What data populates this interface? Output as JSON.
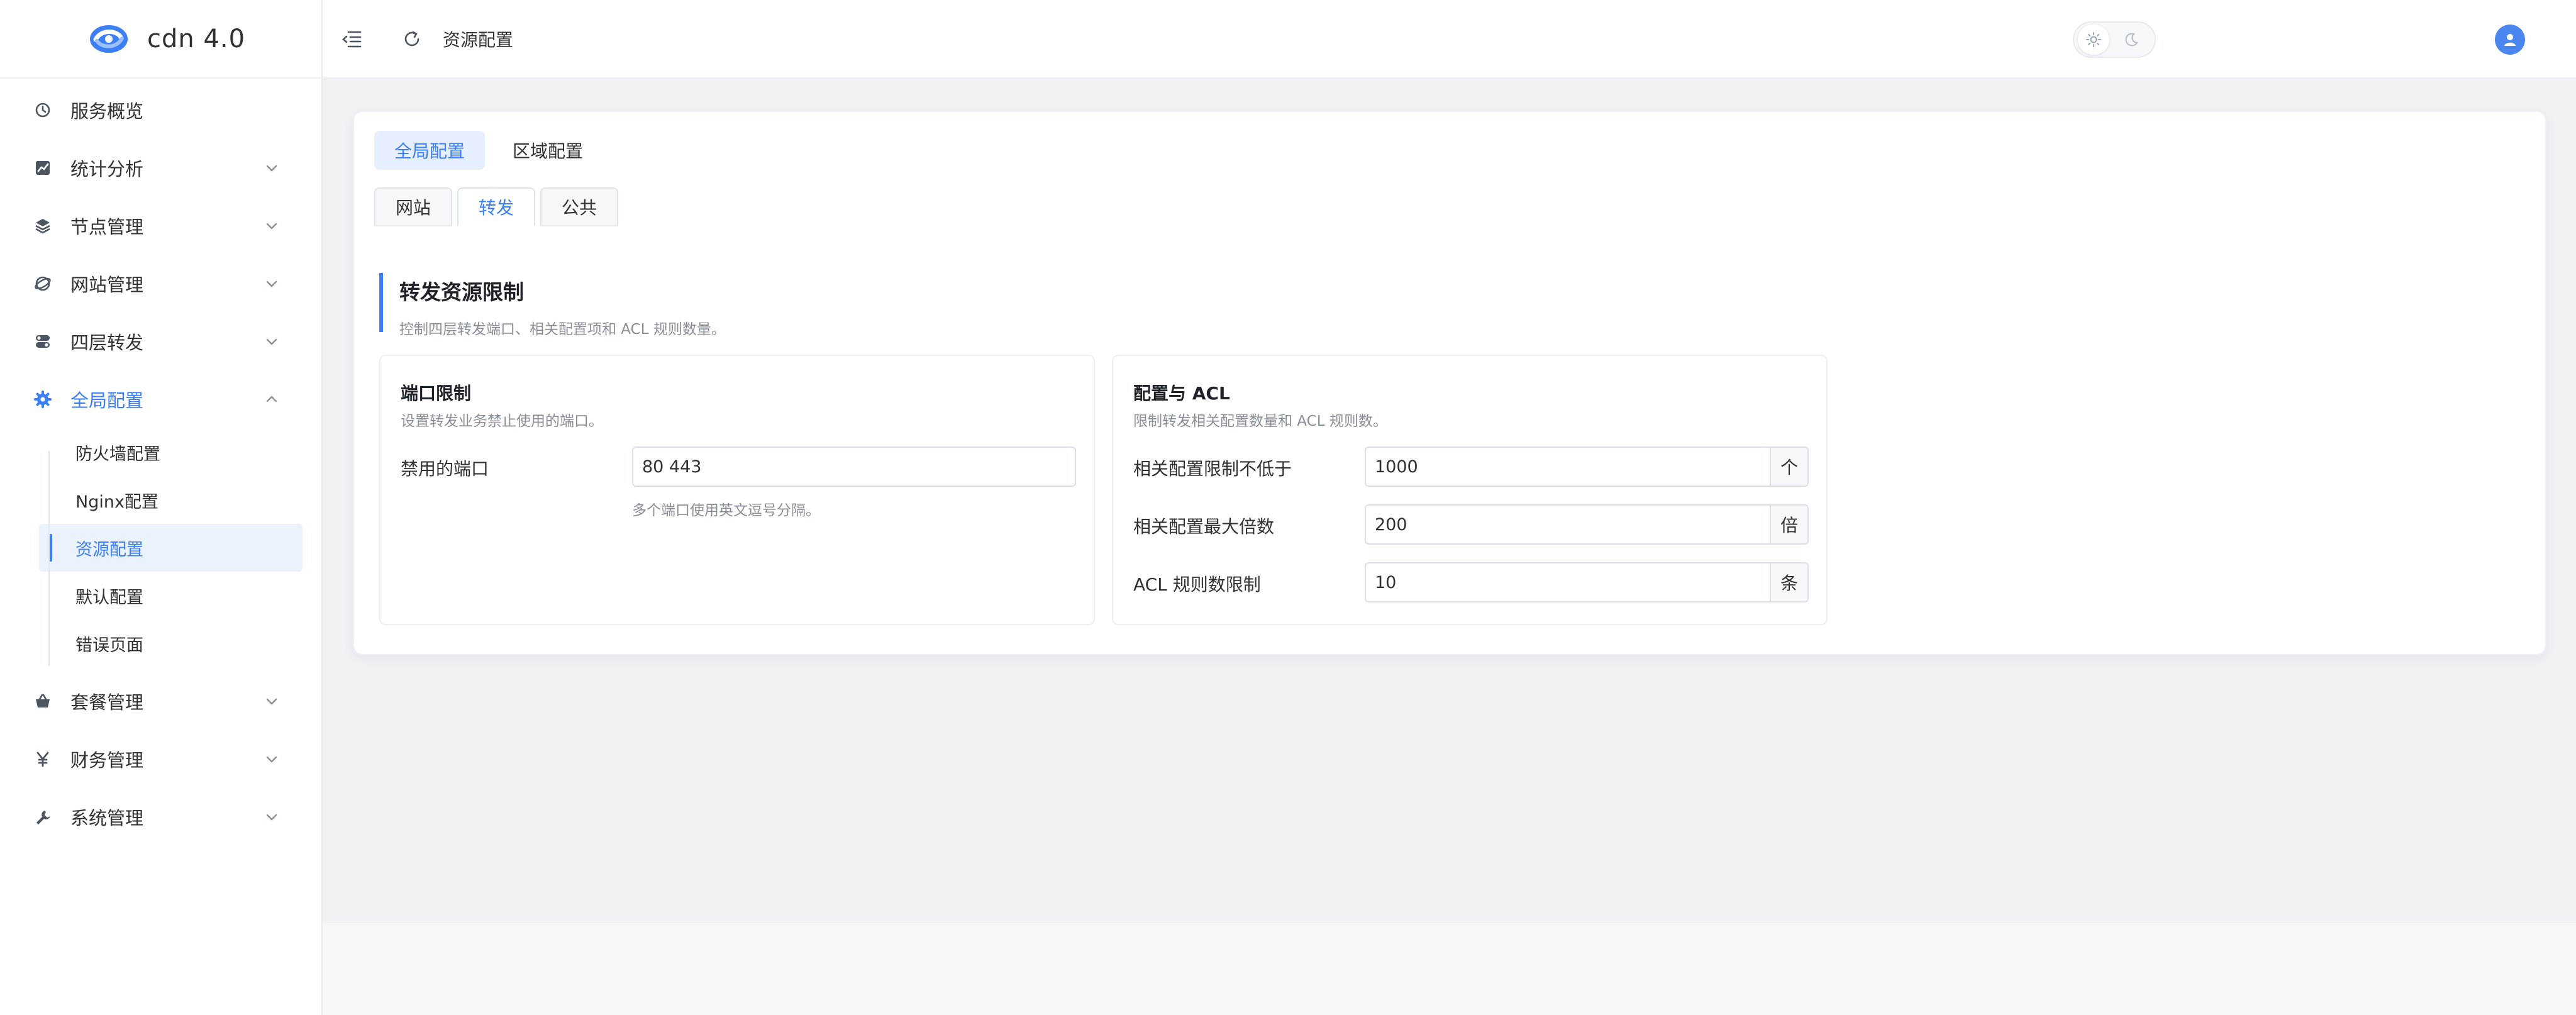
{
  "brand": {
    "title": "cdn 4.0",
    "accent": "#3b7ef5"
  },
  "sidebar": {
    "items": [
      {
        "label": "服务概览",
        "icon": "dashboard-icon",
        "expandable": false
      },
      {
        "label": "统计分析",
        "icon": "chart-icon",
        "expandable": true
      },
      {
        "label": "节点管理",
        "icon": "layers-icon",
        "expandable": true
      },
      {
        "label": "网站管理",
        "icon": "globe-icon",
        "expandable": true
      },
      {
        "label": "四层转发",
        "icon": "toggle-icon",
        "expandable": true
      },
      {
        "label": "全局配置",
        "icon": "gear-icon",
        "expandable": true,
        "expanded": true,
        "active": true
      },
      {
        "label": "套餐管理",
        "icon": "basket-icon",
        "expandable": true
      },
      {
        "label": "财务管理",
        "icon": "yen-icon",
        "expandable": true
      },
      {
        "label": "系统管理",
        "icon": "wrench-icon",
        "expandable": true
      }
    ],
    "submenu": [
      {
        "label": "防火墙配置"
      },
      {
        "label": "Nginx配置"
      },
      {
        "label": "资源配置",
        "active": true
      },
      {
        "label": "默认配置"
      },
      {
        "label": "错误页面"
      }
    ]
  },
  "header": {
    "breadcrumb": "资源配置"
  },
  "tabs": {
    "top": [
      {
        "label": "全局配置",
        "active": true
      },
      {
        "label": "区域配置"
      }
    ],
    "sub": [
      {
        "label": "网站"
      },
      {
        "label": "转发",
        "active": true
      },
      {
        "label": "公共"
      }
    ]
  },
  "section": {
    "title": "转发资源限制",
    "desc": "控制四层转发端口、相关配置项和 ACL 规则数量。"
  },
  "port_panel": {
    "title": "端口限制",
    "desc": "设置转发业务禁止使用的端口。",
    "field_label": "禁用的端口",
    "field_value": "80 443",
    "hint": "多个端口使用英文逗号分隔。"
  },
  "acl_panel": {
    "title": "配置与 ACL",
    "desc": "限制转发相关配置数量和 ACL 规则数。",
    "fields": [
      {
        "label": "相关配置限制不低于",
        "value": "1000",
        "unit": "个"
      },
      {
        "label": "相关配置最大倍数",
        "value": "200",
        "unit": "倍"
      },
      {
        "label": "ACL 规则数限制",
        "value": "10",
        "unit": "条"
      }
    ]
  }
}
